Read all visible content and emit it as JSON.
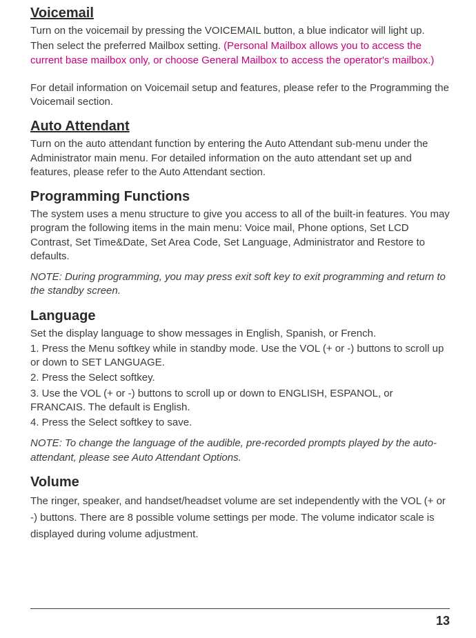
{
  "voicemail": {
    "title": "Voicemail",
    "p1a": "Turn on the voicemail by pressing the VOICEMAIL button, a blue indicator will light up.",
    "p1b_plain": "Then select the preferred Mailbox setting. ",
    "p1b_magenta": "(Personal Mailbox allows you to access the current base mailbox only, or choose General Mailbox to access the operator's mailbox.)",
    "p2": "For detail information on Voicemail setup and features, please refer to the Programming the Voicemail section."
  },
  "auto_attendant": {
    "title": "Auto Attendant",
    "p1": "Turn on the auto attendant function by entering the Auto Attendant sub-menu under the Administrator main menu. For detailed information on the auto attendant set up and features, please refer to the Auto Attendant section."
  },
  "programming": {
    "title": "Programming Functions",
    "p1": "The system uses a menu structure to give you access to all of the built-in features. You may program the following items in the main menu: Voice mail, Phone options, Set LCD Contrast, Set Time&Date, Set Area Code, Set Language, Administrator and Restore to defaults.",
    "note": "NOTE: During programming, you may press exit soft key to exit programming and return to the standby screen."
  },
  "language": {
    "title": "Language",
    "p1": "Set the display language to show messages in English, Spanish, or French.",
    "step1": "1. Press the Menu softkey while in standby mode. Use the VOL (+ or -) buttons to scroll up or down to SET LANGUAGE.",
    "step2": "2. Press the Select softkey.",
    "step3": "3. Use the VOL (+ or -) buttons to scroll up or down to ENGLISH, ESPANOL, or FRANCAIS. The default is English.",
    "step4": "4. Press the Select softkey to save.",
    "note": "NOTE:  To change the language of the audible, pre-recorded prompts played by the auto-attendant, please see Auto Attendant Options."
  },
  "volume": {
    "title": "Volume",
    "p1": "The ringer, speaker, and handset/headset volume are set independently with the VOL (+ or -) buttons. There are 8 possible volume settings per mode. The volume indicator scale is displayed during volume adjustment."
  },
  "page_number": "13"
}
